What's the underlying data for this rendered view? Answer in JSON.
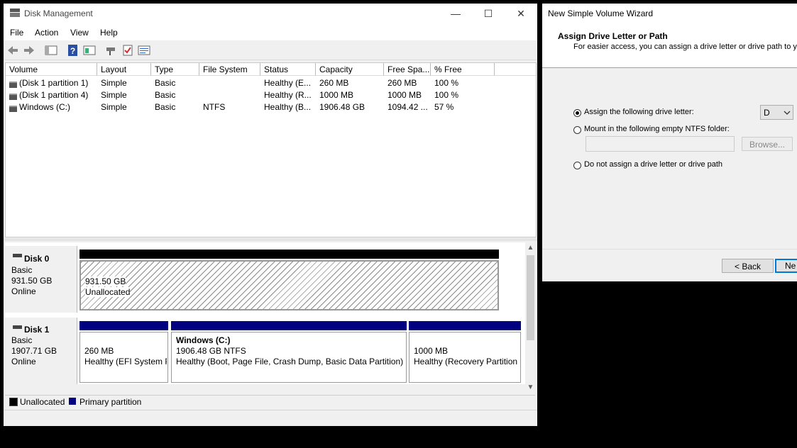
{
  "disk_management": {
    "title": "Disk Management",
    "menu": [
      "File",
      "Action",
      "View",
      "Help"
    ],
    "columns": [
      "Volume",
      "Layout",
      "Type",
      "File System",
      "Status",
      "Capacity",
      "Free Spa...",
      "% Free"
    ],
    "volumes": [
      {
        "volume": "(Disk 1 partition 1)",
        "layout": "Simple",
        "type": "Basic",
        "fs": "",
        "status": "Healthy (E...",
        "capacity": "260 MB",
        "free": "260 MB",
        "pct": "100 %"
      },
      {
        "volume": "(Disk 1 partition 4)",
        "layout": "Simple",
        "type": "Basic",
        "fs": "",
        "status": "Healthy (R...",
        "capacity": "1000 MB",
        "free": "1000 MB",
        "pct": "100 %"
      },
      {
        "volume": "Windows (C:)",
        "layout": "Simple",
        "type": "Basic",
        "fs": "NTFS",
        "status": "Healthy (B...",
        "capacity": "1906.48 GB",
        "free": "1094.42 ...",
        "pct": "57 %"
      }
    ],
    "disks": [
      {
        "name": "Disk 0",
        "kind": "Basic",
        "size": "931.50 GB",
        "state": "Online",
        "partitions": [
          {
            "line1": "931.50 GB",
            "line2": "Unallocated"
          }
        ]
      },
      {
        "name": "Disk 1",
        "kind": "Basic",
        "size": "1907.71 GB",
        "state": "Online",
        "partitions": [
          {
            "line1": "260 MB",
            "line2": "Healthy (EFI System P"
          },
          {
            "title": "Windows  (C:)",
            "line1": "1906.48 GB NTFS",
            "line2": "Healthy (Boot, Page File, Crash Dump, Basic Data Partition)"
          },
          {
            "line1": "1000 MB",
            "line2": "Healthy (Recovery Partition"
          }
        ]
      }
    ],
    "legend": [
      {
        "label": "Unallocated",
        "color": "#000000"
      },
      {
        "label": "Primary partition",
        "color": "#000080"
      }
    ]
  },
  "wizard": {
    "title": "New Simple Volume Wizard",
    "heading": "Assign Drive Letter or Path",
    "subheading": "For easier access, you can assign a drive letter or drive path to you",
    "options": [
      {
        "label": "Assign the following drive letter:",
        "selected": true
      },
      {
        "label": "Mount in the following empty NTFS folder:",
        "selected": false
      },
      {
        "label": "Do not assign a drive letter or drive path",
        "selected": false
      }
    ],
    "drive_letter": "D",
    "folder_path": "",
    "browse_label": "Browse...",
    "back_label": "< Back",
    "next_label": "Ne"
  }
}
